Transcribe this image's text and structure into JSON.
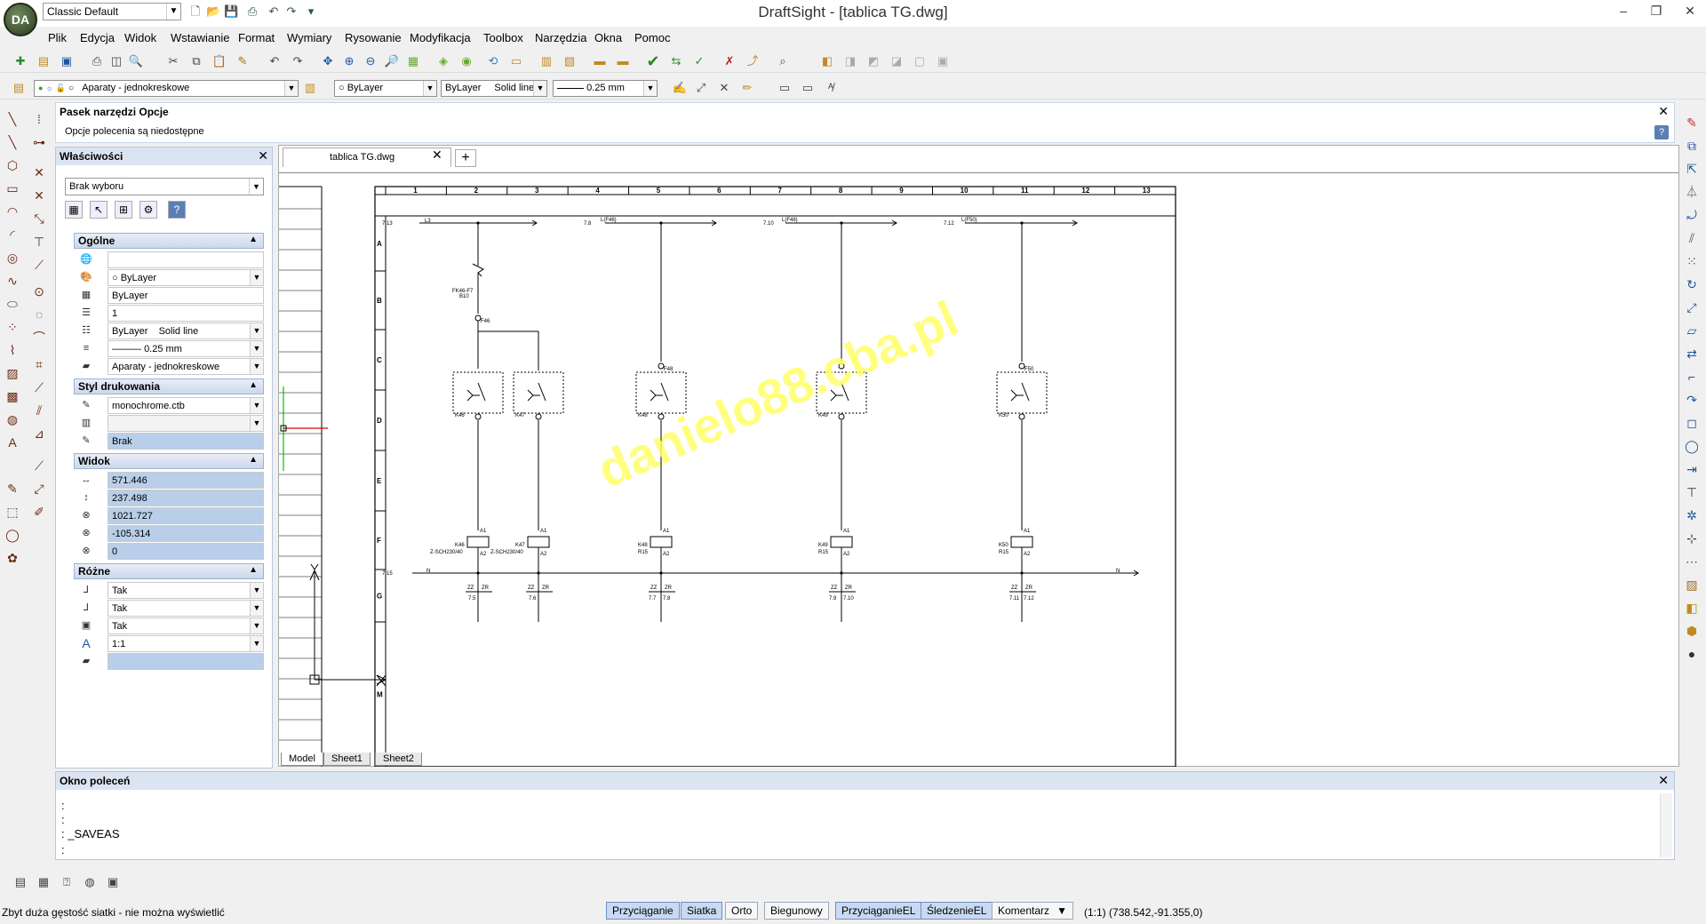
{
  "window": {
    "title": "DraftSight - [tablica TG.dwg]",
    "logo": "DA",
    "workspace": "Classic Default"
  },
  "menu": [
    "Plik",
    "Edycja",
    "Widok",
    "Wstawianie",
    "Format",
    "Wymiary",
    "Rysowanie",
    "Modyfikacja",
    "Toolbox",
    "Narzędzia",
    "Okna",
    "Pomoc"
  ],
  "layer_toolbar": {
    "layer": "Aparaty - jednokreskowe",
    "color": "ByLayer",
    "linetype_layer": "ByLayer",
    "linetype": "Solid line",
    "lineweight": "0.25 mm"
  },
  "options_bar": {
    "title": "Pasek narzędzi Opcje",
    "text": "Opcje polecenia są niedostępne"
  },
  "properties": {
    "title": "Właściwości",
    "selection": "Brak wyboru",
    "sections": {
      "general": "Ogólne",
      "print_style": "Styl drukowania",
      "view": "Widok",
      "misc": "Różne"
    },
    "general": {
      "color": "ByLayer",
      "linetype_scale_source": "ByLayer",
      "scale": "1",
      "linetype_layer": "ByLayer",
      "linetype": "Solid line",
      "lineweight": "0.25 mm",
      "layer": "Aparaty - jednokreskowe"
    },
    "print_style": {
      "table": "monochrome.ctb",
      "style": "",
      "value": "Brak"
    },
    "view": [
      "571.446",
      "237.498",
      "1021.727",
      "-105.314",
      "0"
    ],
    "misc": [
      "Tak",
      "Tak",
      "Tak",
      "1:1",
      ""
    ]
  },
  "document": {
    "tab": "tablica TG.dwg",
    "sheets": [
      "Model",
      "Sheet1",
      "Sheet2"
    ]
  },
  "drawing": {
    "columns": [
      "1",
      "2",
      "3",
      "4",
      "5",
      "6",
      "7",
      "8",
      "9",
      "10",
      "11",
      "12",
      "13"
    ],
    "rows": [
      "A",
      "B",
      "C",
      "D",
      "E",
      "F",
      "G",
      "M"
    ],
    "watermark": "danielo88.cba.pl",
    "labels": {
      "ref1": "7.13",
      "l3": "L3",
      "ref2": "7.8",
      "l1": "L(F46)",
      "ref3": "7.10",
      "l2": "L(F48)",
      "ref4": "7.12",
      "l4": "L(F50)",
      "fk": "FK46-F7",
      "fk2": "B10",
      "f46": "F46",
      "f48": "F48",
      "f50": "F50",
      "k46": "K46",
      "k47": "K47",
      "k48": "K48",
      "k49": "K49",
      "k50": "K50",
      "zsch1": "Z-SCH230/40",
      "zsch2": "Z-SCH230/40",
      "r15a": "R15",
      "r15b": "R15",
      "r15c": "R15",
      "a1": "A1",
      "a2": "A2",
      "n": "N",
      "n_ref": "7.15",
      "zz": "ZZ",
      "zr": "ZR",
      "x1": "7.5",
      "x2": "7.6",
      "x3": "7.7",
      "x4": "7.8",
      "x5": "7.9",
      "x6": "7.10",
      "x7": "7.11",
      "x8": "7.12",
      "k46b": "K46",
      "k47b": "K47",
      "k48b": "K48",
      "k49b": "K49",
      "k50b": "K50"
    }
  },
  "command_window": {
    "title": "Okno poleceń",
    "lines": [
      ":",
      ":",
      ": _SAVEAS",
      ":"
    ]
  },
  "status": {
    "message": "Zbyt duża gęstość siatki - nie można wyświetlić",
    "buttons": [
      "Przyciąganie",
      "Siatka",
      "Orto",
      "Biegunowy",
      "PrzyciąganieEL",
      "ŚledzenieEL"
    ],
    "comment": "Komentarz",
    "scale": "(1:1)",
    "coords": "(738.542,-91.355,0)"
  }
}
